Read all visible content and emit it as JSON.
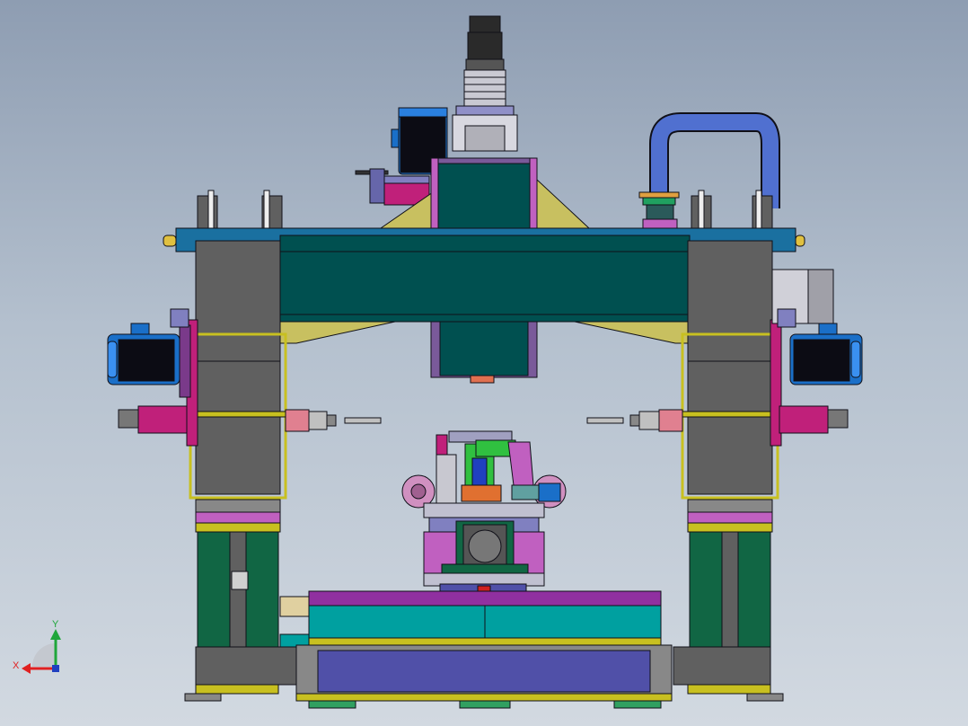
{
  "triad": {
    "x_label": "X",
    "y_label": "Y",
    "x_color": "#e02020",
    "y_color": "#1fa63a"
  },
  "colors": {
    "beam": "#005050",
    "column": "#606060",
    "frame_yellow": "#c8c020",
    "motor_blue": "#1a6fc8",
    "magenta": "#c0207a",
    "pipe_blue": "#5070d0",
    "base_purple": "#5050a8",
    "cyan_rail": "#00a0a0",
    "lower_green": "#116644",
    "outline": "#101018"
  }
}
